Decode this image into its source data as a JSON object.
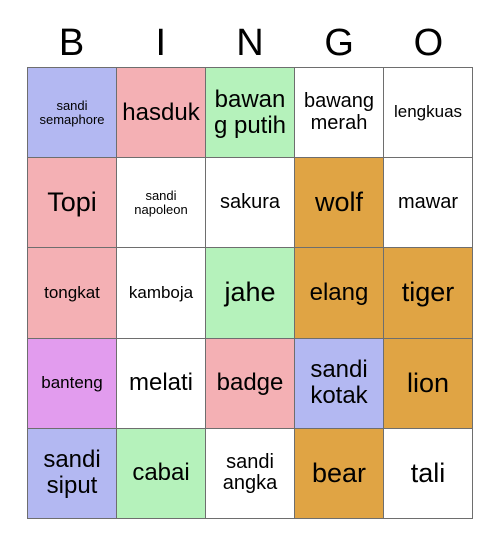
{
  "card": {
    "headers": [
      "B",
      "I",
      "N",
      "G",
      "O"
    ],
    "colors": {
      "white": "#ffffff",
      "blue": "#b3b8f2",
      "pink": "#f4b0b4",
      "green": "#b5f2bb",
      "orange": "#e0a444",
      "violet": "#e29cee",
      "border": "#6e6e6e",
      "text": "#000000"
    },
    "rows": [
      [
        {
          "label": "sandi semaphore",
          "color": "blue",
          "size": "fs-xs"
        },
        {
          "label": "hasduk",
          "color": "pink",
          "size": "fs-lg"
        },
        {
          "label": "bawang putih",
          "color": "green",
          "size": "fs-lg"
        },
        {
          "label": "bawang merah",
          "color": "white",
          "size": "fs-md"
        },
        {
          "label": "lengkuas",
          "color": "white",
          "size": "fs-sm"
        }
      ],
      [
        {
          "label": "Topi",
          "color": "pink",
          "size": "fs-xl"
        },
        {
          "label": "sandi napoleon",
          "color": "white",
          "size": "fs-xs"
        },
        {
          "label": "sakura",
          "color": "white",
          "size": "fs-md"
        },
        {
          "label": "wolf",
          "color": "orange",
          "size": "fs-xl"
        },
        {
          "label": "mawar",
          "color": "white",
          "size": "fs-md"
        }
      ],
      [
        {
          "label": "tongkat",
          "color": "pink",
          "size": "fs-sm"
        },
        {
          "label": "kamboja",
          "color": "white",
          "size": "fs-sm"
        },
        {
          "label": "jahe",
          "color": "green",
          "size": "fs-xl"
        },
        {
          "label": "elang",
          "color": "orange",
          "size": "fs-lg"
        },
        {
          "label": "tiger",
          "color": "orange",
          "size": "fs-xl"
        }
      ],
      [
        {
          "label": "banteng",
          "color": "violet",
          "size": "fs-sm"
        },
        {
          "label": "melati",
          "color": "white",
          "size": "fs-lg"
        },
        {
          "label": "badge",
          "color": "pink",
          "size": "fs-lg"
        },
        {
          "label": "sandi kotak",
          "color": "blue",
          "size": "fs-lg"
        },
        {
          "label": "lion",
          "color": "orange",
          "size": "fs-xl"
        }
      ],
      [
        {
          "label": "sandi siput",
          "color": "blue",
          "size": "fs-lg"
        },
        {
          "label": "cabai",
          "color": "green",
          "size": "fs-lg"
        },
        {
          "label": "sandi angka",
          "color": "white",
          "size": "fs-md"
        },
        {
          "label": "bear",
          "color": "orange",
          "size": "fs-xl"
        },
        {
          "label": "tali",
          "color": "white",
          "size": "fs-xl"
        }
      ]
    ]
  }
}
